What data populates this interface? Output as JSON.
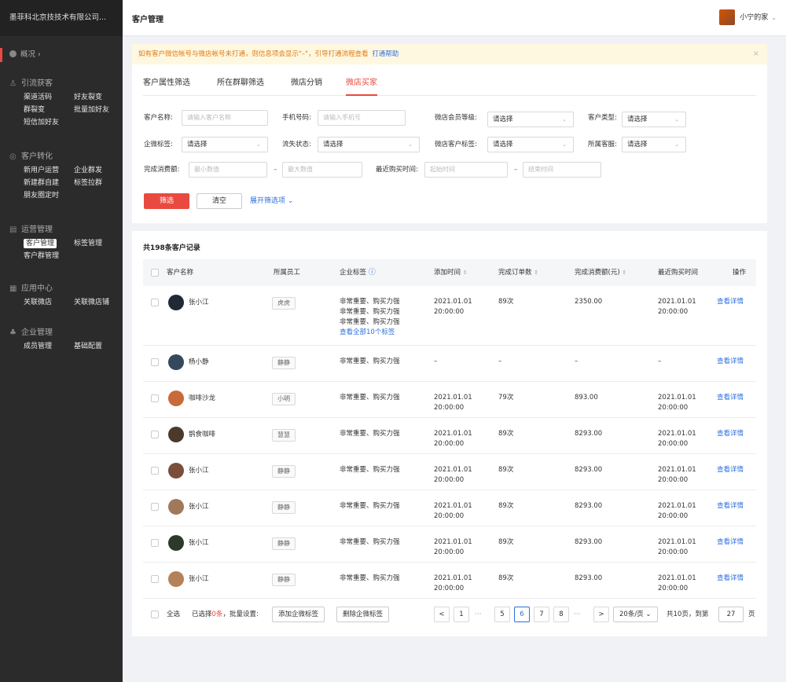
{
  "sidebar": {
    "company": "墨菲科北京技技术有限公司...",
    "overview": "概况 ›",
    "groups": [
      {
        "title": "引流获客",
        "items": [
          "渠道活码",
          "好友裂变",
          "群裂变",
          "批量加好友",
          "短信加好友"
        ]
      },
      {
        "title": "客户转化",
        "items": [
          "新用户运营",
          "企业群发",
          "新建群自建",
          "标签拉群",
          "朋友圈定时"
        ]
      },
      {
        "title": "运营管理",
        "items": [
          "客户管理",
          "标签管理",
          "客户群管理"
        ]
      },
      {
        "title": "应用中心",
        "items": [
          "关联微店",
          "关联微店铺"
        ]
      },
      {
        "title": "企业管理",
        "items": [
          "成员管理",
          "基础配置"
        ]
      }
    ]
  },
  "topbar": {
    "title": "客户管理",
    "user": "小宁的家"
  },
  "notice": {
    "text": "如有客户微信帐号与微店帐号未打通，则信息项会显示\"–\"，引导打通流程查看",
    "link": "打通帮助",
    "close": "×"
  },
  "tabs": [
    "客户属性筛选",
    "所在群聊筛选",
    "微店分销",
    "微店买家"
  ],
  "filters": {
    "customer_name_label": "客户名称:",
    "customer_name_ph": "请输入客户名称",
    "phone_label": "手机号码:",
    "phone_ph": "请输入手机号",
    "member_level_label": "微店会员等级:",
    "customer_type_label": "客户类型:",
    "wecom_tag_label": "企微标签:",
    "churn_label": "流失状态:",
    "shop_tag_label": "微店客户标签:",
    "service_label": "所属客服:",
    "select_ph": "请选择",
    "spend_label": "完成消费额:",
    "min_ph": "最小数值",
    "max_ph": "最大数值",
    "last_buy_label": "最近购买时间:",
    "start_ph": "起始时间",
    "end_ph": "结束时间",
    "dash": "–",
    "btn_filter": "筛选",
    "btn_clear": "清空",
    "expand": "展开筛选项 ⌄"
  },
  "table": {
    "record_count": "共198条客户记录",
    "headers": {
      "name": "客户名称",
      "staff": "所属员工",
      "tags": "企业标签",
      "added": "添加时间",
      "orders": "完成订单数",
      "spend": "完成消费额(元)",
      "last_buy": "最近购买时间",
      "action": "操作"
    },
    "view_label": "查看详情",
    "rows": [
      {
        "name": "张小江",
        "staff": "虎虎",
        "tags": [
          "非常重要、购买力强",
          "非常重要、购买力强",
          "非常重要、购买力强"
        ],
        "tags_more": "查看全部10个标签",
        "added": [
          "2021.01.01",
          "20:00:00"
        ],
        "orders": "89次",
        "spend": "2350.00",
        "last": [
          "2021.01.01",
          "20:00:00"
        ]
      },
      {
        "name": "杨小静",
        "staff": "静静",
        "tags": [
          "非常重要、购买力强"
        ],
        "added": [
          "–",
          ""
        ],
        "orders": "–",
        "spend": "–",
        "last": [
          "–",
          ""
        ]
      },
      {
        "name": "咖啡沙龙",
        "staff": "小明",
        "tags": [
          "非常重要、购买力强"
        ],
        "added": [
          "2021.01.01",
          "20:00:00"
        ],
        "orders": "79次",
        "spend": "893.00",
        "last": [
          "2021.01.01",
          "20:00:00"
        ]
      },
      {
        "name": "鹊食咖啡",
        "staff": "慧慧",
        "tags": [
          "非常重要、购买力强"
        ],
        "added": [
          "2021.01.01",
          "20:00:00"
        ],
        "orders": "89次",
        "spend": "8293.00",
        "last": [
          "2021.01.01",
          "20:00:00"
        ]
      },
      {
        "name": "张小江",
        "staff": "静静",
        "tags": [
          "非常重要、购买力强"
        ],
        "added": [
          "2021.01.01",
          "20:00:00"
        ],
        "orders": "89次",
        "spend": "8293.00",
        "last": [
          "2021.01.01",
          "20:00:00"
        ]
      },
      {
        "name": "张小江",
        "staff": "静静",
        "tags": [
          "非常重要、购买力强"
        ],
        "added": [
          "2021.01.01",
          "20:00:00"
        ],
        "orders": "89次",
        "spend": "8293.00",
        "last": [
          "2021.01.01",
          "20:00:00"
        ]
      },
      {
        "name": "张小江",
        "staff": "静静",
        "tags": [
          "非常重要、购买力强"
        ],
        "added": [
          "2021.01.01",
          "20:00:00"
        ],
        "orders": "89次",
        "spend": "8293.00",
        "last": [
          "2021.01.01",
          "20:00:00"
        ]
      },
      {
        "name": "张小江",
        "staff": "静静",
        "tags": [
          "非常重要、购买力强"
        ],
        "added": [
          "2021.01.01",
          "20:00:00"
        ],
        "orders": "89次",
        "spend": "8293.00",
        "last": [
          "2021.01.01",
          "20:00:00"
        ]
      }
    ]
  },
  "footer": {
    "select_all": "全选",
    "selected_prefix": "已选择",
    "selected_count": "0条",
    "selected_suffix": "，批量设置:",
    "add_tag": "添加企微标签",
    "remove_tag": "删除企微标签",
    "pages": [
      "1",
      "5",
      "6",
      "7",
      "8"
    ],
    "current_page": "6",
    "prev": "<",
    "next": ">",
    "ellipsis": "···",
    "page_size": "20条/页 ⌄",
    "total_pages": "共10页，到第",
    "goto_value": "27",
    "page_unit": "页"
  },
  "colors": {
    "accent": "#e94a3f",
    "link": "#2f6fdc",
    "sidebar_bg": "#2b2b2b",
    "notice_bg": "#fff8e1"
  },
  "icons": {
    "overview": "dashboard-icon",
    "acquire": "user-icon",
    "convert": "target-icon",
    "operate": "grid-icon",
    "apps": "apps-icon",
    "org": "org-icon",
    "info": "info-icon"
  }
}
